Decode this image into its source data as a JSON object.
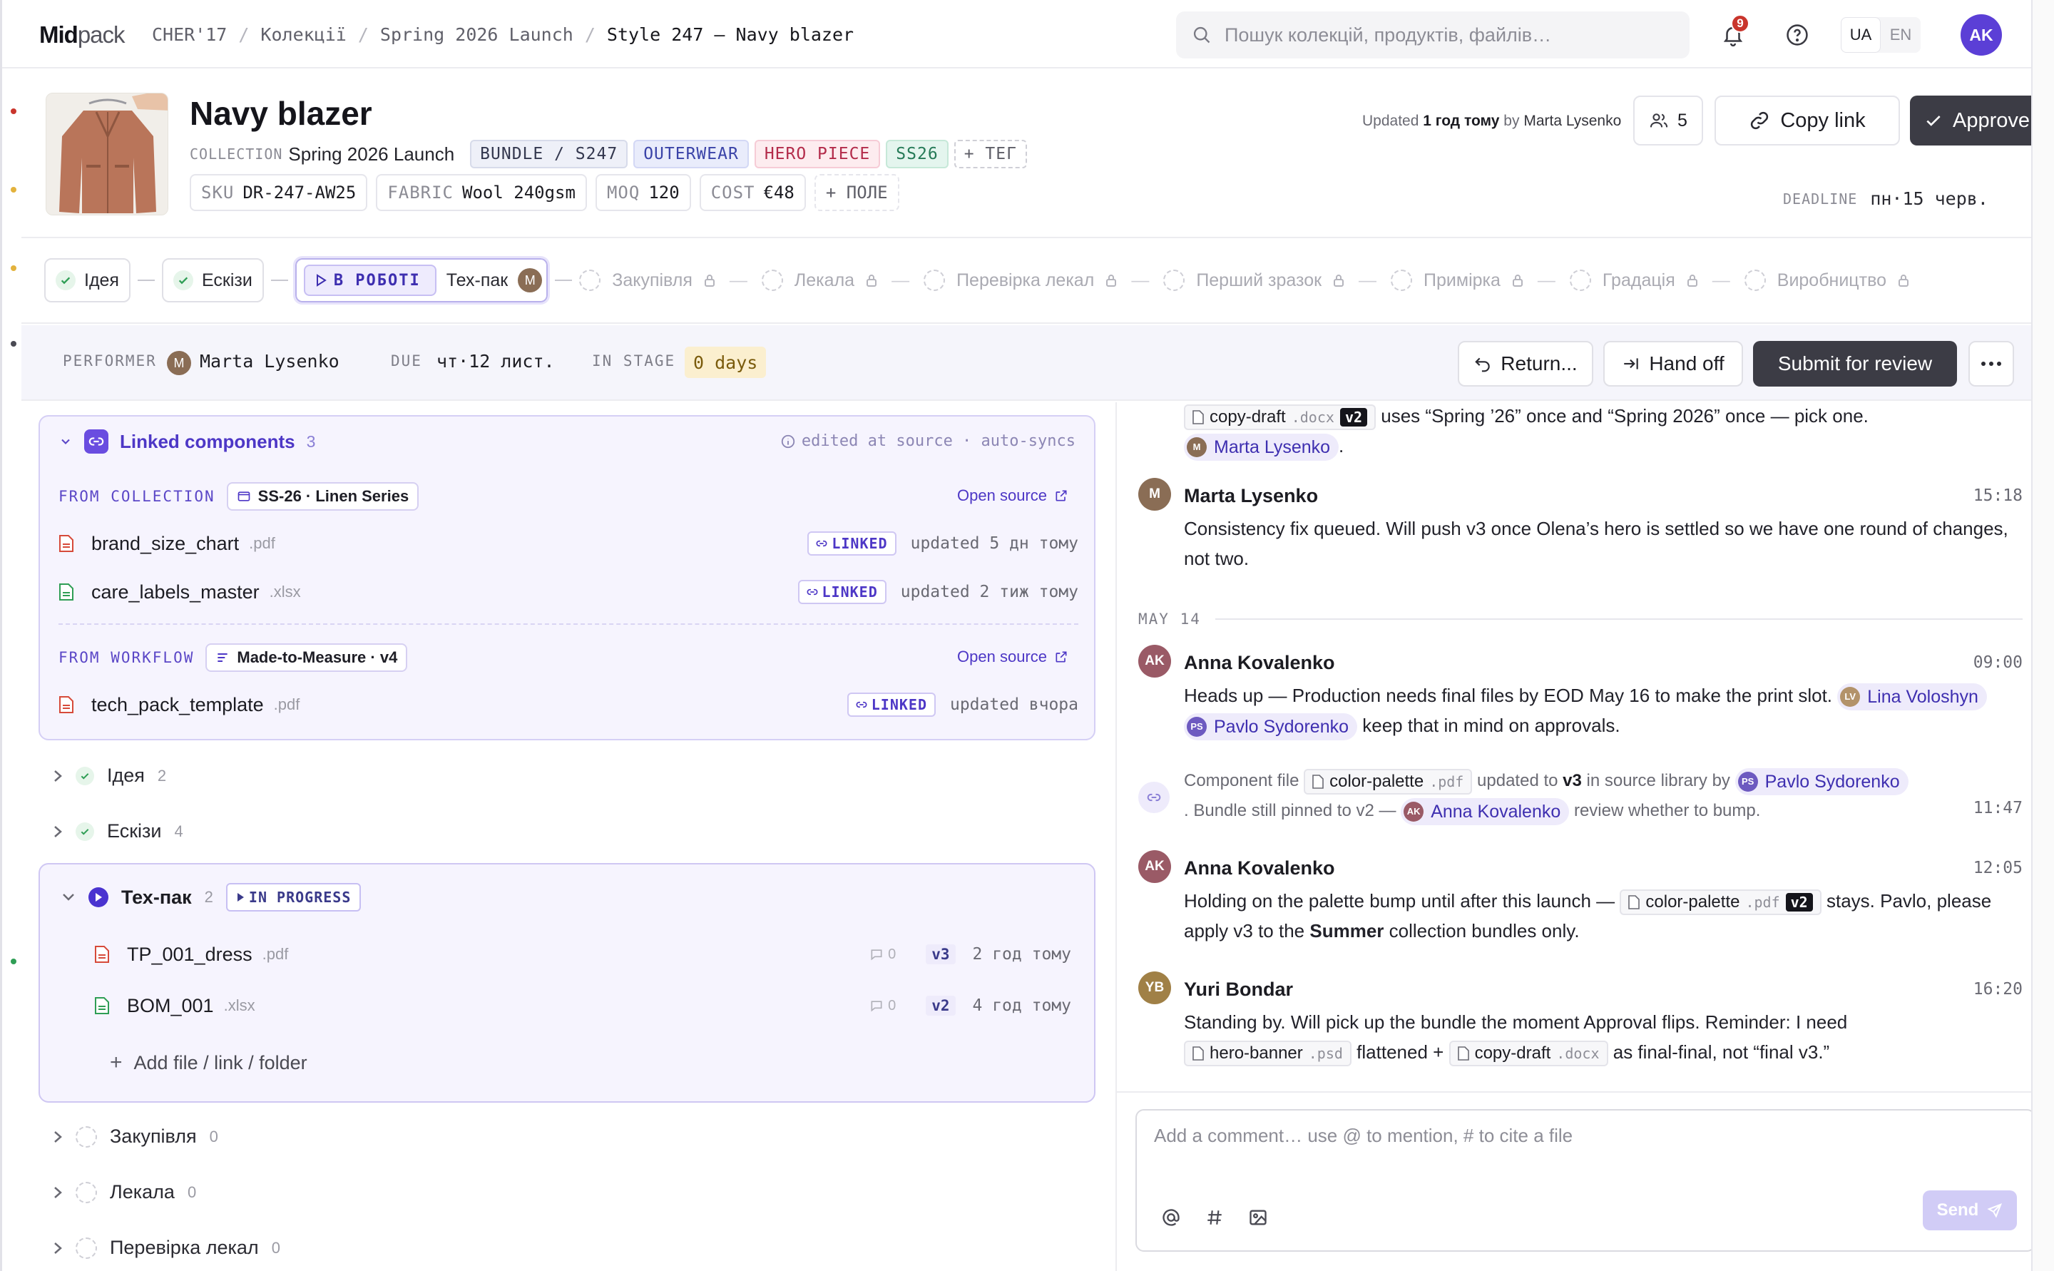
{
  "app": {
    "brand_bold": "Mid",
    "brand_rest": "pack"
  },
  "breadcrumb": [
    "CHER'17",
    "Колекції",
    "Spring 2026 Launch",
    "Style 247 — Navy blazer"
  ],
  "search": {
    "placeholder": "Пошук колекцій, продуктів, файлів…"
  },
  "notifications": {
    "count": "9"
  },
  "lang": {
    "ua": "UA",
    "en": "EN",
    "active": "UA"
  },
  "user": {
    "initials": "AK"
  },
  "product": {
    "title": "Navy blazer",
    "collection_label": "COLLECTION",
    "collection": "Spring 2026 Launch",
    "tags": [
      {
        "text": "BUNDLE / S247",
        "bg": "#eef0f8",
        "fg": "#34384f",
        "border": "#d7dbea"
      },
      {
        "text": "OUTERWEAR",
        "bg": "#e9ecfb",
        "fg": "#3a43a8",
        "border": "#d3d8f5"
      },
      {
        "text": "HERO PIECE",
        "bg": "#fdecef",
        "fg": "#b32b4a",
        "border": "#f6ccd6"
      },
      {
        "text": "SS26",
        "bg": "#e4f5ee",
        "fg": "#257a57",
        "border": "#c6e8d8"
      }
    ],
    "add_tag": "+ ТЕГ",
    "fields": [
      {
        "k": "SKU",
        "v": "DR-247-AW25"
      },
      {
        "k": "FABRIC",
        "v": "Wool 240gsm"
      },
      {
        "k": "MOQ",
        "v": "120"
      },
      {
        "k": "COST",
        "v": "€48"
      }
    ],
    "add_field": "+ ПОЛЕ",
    "updated_prefix": "Updated",
    "updated_when": "1 год тому",
    "updated_by_prefix": "by",
    "updated_by": "Marta Lysenko",
    "people_count": "5",
    "copy_link": "Copy link",
    "approve": "Approve",
    "deadline_label": "DEADLINE",
    "deadline": "пн·15 черв."
  },
  "stages": {
    "done": [
      "Ідея",
      "Ескізи"
    ],
    "active_badge": "В РОБОТІ",
    "active": "Тех-пак",
    "active_avatar": "M",
    "pending": [
      "Закупівля",
      "Лекала",
      "Перевірка лекал",
      "Перший зразок",
      "Примірка",
      "Градація",
      "Виробництво"
    ]
  },
  "performer": {
    "label": "PERFORMER",
    "avatar": "M",
    "name": "Marta Lysenko",
    "due_label": "DUE",
    "due": "чт·12 лист.",
    "stage_label": "IN STAGE",
    "in_stage": "0 days",
    "return": "Return...",
    "handoff": "Hand off",
    "submit": "Submit for review"
  },
  "linked": {
    "title": "Linked components",
    "count": "3",
    "note": "edited at source · auto-syncs",
    "groups": [
      {
        "from": "FROM COLLECTION",
        "source": "SS-26 · Linen Series",
        "open": "Open source",
        "files": [
          {
            "name": "brand_size_chart",
            "ext": ".pdf",
            "tag": "LINKED",
            "upd": "updated 5 дн тому",
            "type": "pdf"
          },
          {
            "name": "care_labels_master",
            "ext": ".xlsx",
            "tag": "LINKED",
            "upd": "updated 2 тиж тому",
            "type": "xlsx"
          }
        ]
      },
      {
        "from": "FROM WORKFLOW",
        "source": "Made-to-Measure · v4",
        "open": "Open source",
        "files": [
          {
            "name": "tech_pack_template",
            "ext": ".pdf",
            "tag": "LINKED",
            "upd": "updated вчора",
            "type": "pdf"
          }
        ]
      }
    ]
  },
  "stage_groups": {
    "idea": {
      "name": "Ідея",
      "count": "2"
    },
    "sketch": {
      "name": "Ескізи",
      "count": "4"
    },
    "techpack": {
      "name": "Тех-пак",
      "count": "2",
      "badge": "IN PROGRESS",
      "files": [
        {
          "name": "TP_001_dress",
          "ext": ".pdf",
          "comments": "0",
          "ver": "v3",
          "when": "2 год тому",
          "type": "pdf"
        },
        {
          "name": "BOM_001",
          "ext": ".xlsx",
          "comments": "0",
          "ver": "v2",
          "when": "4 год тому",
          "type": "xlsx"
        }
      ],
      "add": "Add file / link / folder"
    },
    "pending": [
      {
        "name": "Закупівля",
        "count": "0"
      },
      {
        "name": "Лекала",
        "count": "0"
      },
      {
        "name": "Перевірка лекал",
        "count": "0"
      }
    ]
  },
  "chat": {
    "m0": {
      "file": "copy-draft",
      "ext": ".docx",
      "ver": "v2",
      "text1": "uses “Spring ’26” once and “Spring 2026” once — pick one.",
      "mention": "Marta Lysenko",
      "mention_av": "M",
      "tail": "."
    },
    "m1": {
      "av": "M",
      "author": "Marta Lysenko",
      "time": "15:18",
      "text": "Consistency fix queued. Will push v3 once Olena’s hero is settled so we have one round of changes, not two."
    },
    "day": "MAY 14",
    "m2": {
      "av": "AK",
      "author": "Anna Kovalenko",
      "time": "09:00",
      "text": "Heads up — Production needs final files by EOD May 16 to make the print slot.",
      "mention1": "Lina Voloshyn",
      "mention1_av": "LV",
      "mention2": "Pavlo Sydorenko",
      "mention2_av": "PS",
      "text2": "keep that in mind on approvals."
    },
    "sys": {
      "t1": "Component file",
      "file": "color-palette",
      "ext": ".pdf",
      "t2": "updated to",
      "ver": "v3",
      "t3": "in source library by",
      "mention": "Pavlo Sydorenko",
      "mention_av": "PS",
      "t4": ". Bundle still pinned to v2 —",
      "mention2": "Anna Kovalenko",
      "mention2_av": "AK",
      "t5": "review whether to bump.",
      "time": "11:47"
    },
    "m3": {
      "av": "AK",
      "author": "Anna Kovalenko",
      "time": "12:05",
      "t1": "Holding on the palette bump until after this launch —",
      "file": "color-palette",
      "ext": ".pdf",
      "ver": "v2",
      "t2": "stays. Pavlo, please apply v3 to the",
      "bold": "Summer",
      "t3": "collection bundles only."
    },
    "m4": {
      "av": "YB",
      "author": "Yuri Bondar",
      "time": "16:20",
      "t1": "Standing by. Will pick up the bundle the moment Approval flips. Reminder: I need",
      "file1": "hero-banner",
      "ext1": ".psd",
      "t2": "flattened +",
      "file2": "copy-draft",
      "ext2": ".docx",
      "t3": "as final-final, not “final v3.”"
    },
    "composer": {
      "placeholder": "Add a comment… use @ to mention, # to cite a file",
      "send": "Send"
    }
  },
  "colors": {
    "accent": "#5b3fd6",
    "dark_button": "#3c3c45",
    "success": "#2f9e55",
    "pdf": "#d64a3a",
    "xlsx": "#2f9e55"
  }
}
